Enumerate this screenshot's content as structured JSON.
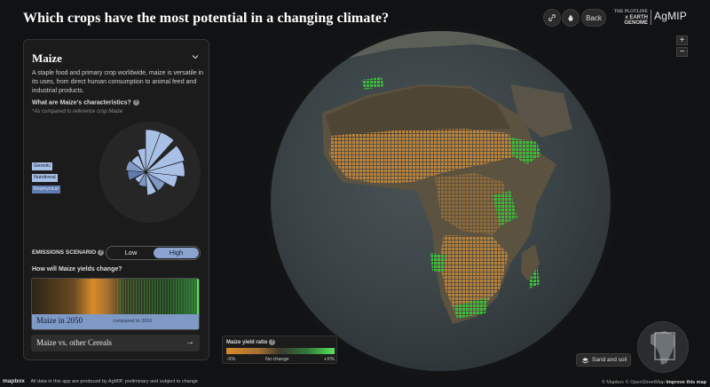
{
  "header": {
    "title": "Which crops have the most potential in a changing climate?",
    "back_label": "Back",
    "logo_plotline_line1": "THE PLOTLINE",
    "logo_plotline_line2": "x EARTH GENOME",
    "logo_agmip": "AgMIP"
  },
  "zoom": {
    "in": "+",
    "out": "−"
  },
  "panel": {
    "crop_name": "Maize",
    "description": "A staple food and primary crop worldwide, maize is versatile in its uses, from direct human consumption to animal feed and industrial products.",
    "characteristics_title": "What are Maize's characteristics?",
    "characteristics_note": "*As compared to reference crop Maize",
    "legend": [
      "Genetic",
      "Nutritional",
      "Biophysical"
    ],
    "emissions_label": "EMISSIONS SCENARIO",
    "emissions_options": [
      "Low",
      "High"
    ],
    "emissions_selected": "High",
    "yield_question": "How will Maize yields change?",
    "yield_title": "Maize in 2050",
    "yield_subtitle": "compared to 2010",
    "compare_label": "Maize vs. other Cereals",
    "compare_arrow": "→"
  },
  "ratio_legend": {
    "title": "Maize yield ratio",
    "left": "-X%",
    "middle": "No change",
    "right": "+X%"
  },
  "sand_button": "Sand and soil",
  "footer": {
    "mapbox": "mapbox",
    "note": "All data in this app are produced by AgMIP, preliminary and subject to change",
    "attribution": "© Mapbox © OpenStreetMap",
    "improve": "Improve this map"
  },
  "colors": {
    "accent": "#8aa3cf",
    "decline": "#d98a2a",
    "increase": "#5be35b"
  }
}
